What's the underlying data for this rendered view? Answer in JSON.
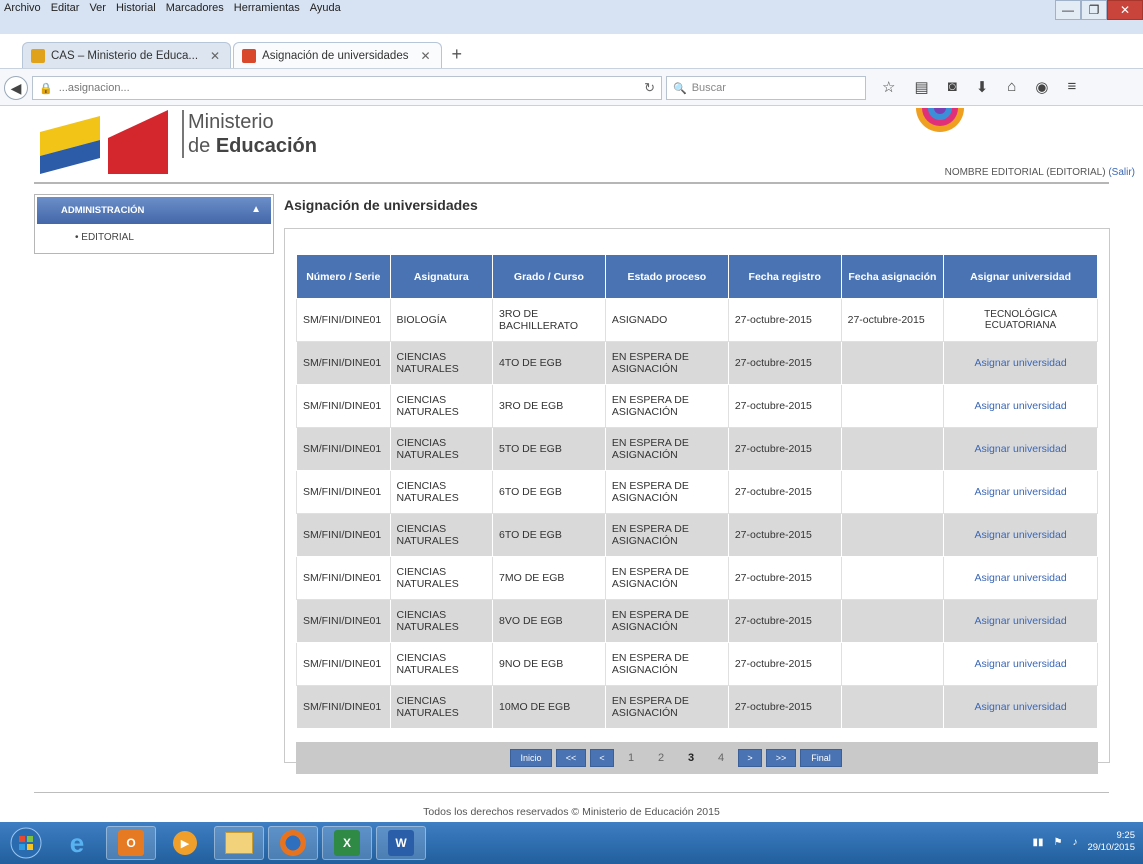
{
  "browser": {
    "menu": [
      "Archivo",
      "Editar",
      "Ver",
      "Historial",
      "Marcadores",
      "Herramientas",
      "Ayuda"
    ],
    "window_controls": {
      "minimize": "—",
      "maximize": "❐",
      "close": "✕"
    },
    "tabs": [
      {
        "title": "CAS – Ministerio de Educa...",
        "active": false,
        "favicon_color": "#e0a21b"
      },
      {
        "title": "Asignación de universidades",
        "active": true,
        "favicon_color": "#d9482b"
      }
    ],
    "new_tab": "+",
    "url": "...asignacion...",
    "search_placeholder": "Buscar",
    "nav_icons": [
      "star-icon",
      "bookmarks-icon",
      "pocket-icon",
      "download-icon",
      "home-icon",
      "menu-icon"
    ]
  },
  "header": {
    "ministry_line1": "Ministerio",
    "ministry_line2_prefix": "de ",
    "ministry_line2_bold": "Educación",
    "user_text": "NOMBRE EDITORIAL (EDITORIAL)",
    "user_link": "(Salir)"
  },
  "sidebar": {
    "header": "ADMINISTRACIÓN",
    "items": [
      "EDITORIAL"
    ]
  },
  "main": {
    "title": "Asignación de universidades",
    "columns": [
      "Número / Serie",
      "Asignatura",
      "Grado / Curso",
      "Estado proceso",
      "Fecha registro",
      "Fecha asignación",
      "Asignar universidad"
    ],
    "rows": [
      {
        "serie": "SM/FINI/DINE01",
        "asignatura": "BIOLOGÍA",
        "grado": "3RO DE BACHILLERATO",
        "estado": "ASIGNADO",
        "fecha_registro": "27-octubre-2015",
        "fecha_asignacion": "27-octubre-2015",
        "accion": "TECNOLÓGICA ECUATORIANA",
        "asignada": true
      },
      {
        "serie": "SM/FINI/DINE01",
        "asignatura": "CIENCIAS NATURALES",
        "grado": "4TO DE EGB",
        "estado": "EN ESPERA DE ASIGNACIÓN",
        "fecha_registro": "27-octubre-2015",
        "fecha_asignacion": "",
        "accion": "Asignar universidad",
        "asignada": false
      },
      {
        "serie": "SM/FINI/DINE01",
        "asignatura": "CIENCIAS NATURALES",
        "grado": "3RO DE EGB",
        "estado": "EN ESPERA DE ASIGNACIÓN",
        "fecha_registro": "27-octubre-2015",
        "fecha_asignacion": "",
        "accion": "Asignar universidad",
        "asignada": false
      },
      {
        "serie": "SM/FINI/DINE01",
        "asignatura": "CIENCIAS NATURALES",
        "grado": "5TO DE EGB",
        "estado": "EN ESPERA DE ASIGNACIÓN",
        "fecha_registro": "27-octubre-2015",
        "fecha_asignacion": "",
        "accion": "Asignar universidad",
        "asignada": false
      },
      {
        "serie": "SM/FINI/DINE01",
        "asignatura": "CIENCIAS NATURALES",
        "grado": "6TO DE EGB",
        "estado": "EN ESPERA DE ASIGNACIÓN",
        "fecha_registro": "27-octubre-2015",
        "fecha_asignacion": "",
        "accion": "Asignar universidad",
        "asignada": false
      },
      {
        "serie": "SM/FINI/DINE01",
        "asignatura": "CIENCIAS NATURALES",
        "grado": "6TO DE EGB",
        "estado": "EN ESPERA DE ASIGNACIÓN",
        "fecha_registro": "27-octubre-2015",
        "fecha_asignacion": "",
        "accion": "Asignar universidad",
        "asignada": false
      },
      {
        "serie": "SM/FINI/DINE01",
        "asignatura": "CIENCIAS NATURALES",
        "grado": "7MO DE EGB",
        "estado": "EN ESPERA DE ASIGNACIÓN",
        "fecha_registro": "27-octubre-2015",
        "fecha_asignacion": "",
        "accion": "Asignar universidad",
        "asignada": false
      },
      {
        "serie": "SM/FINI/DINE01",
        "asignatura": "CIENCIAS NATURALES",
        "grado": "8VO DE EGB",
        "estado": "EN ESPERA DE ASIGNACIÓN",
        "fecha_registro": "27-octubre-2015",
        "fecha_asignacion": "",
        "accion": "Asignar universidad",
        "asignada": false
      },
      {
        "serie": "SM/FINI/DINE01",
        "asignatura": "CIENCIAS NATURALES",
        "grado": "9NO DE EGB",
        "estado": "EN ESPERA DE ASIGNACIÓN",
        "fecha_registro": "27-octubre-2015",
        "fecha_asignacion": "",
        "accion": "Asignar universidad",
        "asignada": false
      },
      {
        "serie": "SM/FINI/DINE01",
        "asignatura": "CIENCIAS NATURALES",
        "grado": "10MO DE EGB",
        "estado": "EN ESPERA DE ASIGNACIÓN",
        "fecha_registro": "27-octubre-2015",
        "fecha_asignacion": "",
        "accion": "Asignar universidad",
        "asignada": false
      }
    ],
    "pager": {
      "first": "Inicio",
      "prev_block": "<<",
      "prev": "<",
      "pages": [
        "1",
        "2",
        "3",
        "4"
      ],
      "current_page": "3",
      "next": ">",
      "next_block": ">>",
      "last": "Final"
    }
  },
  "footer": {
    "text": "Todos los derechos reservados © Ministerio de Educación 2015"
  },
  "taskbar": {
    "clock_time": "9:25",
    "clock_date": "29/10/2015"
  }
}
